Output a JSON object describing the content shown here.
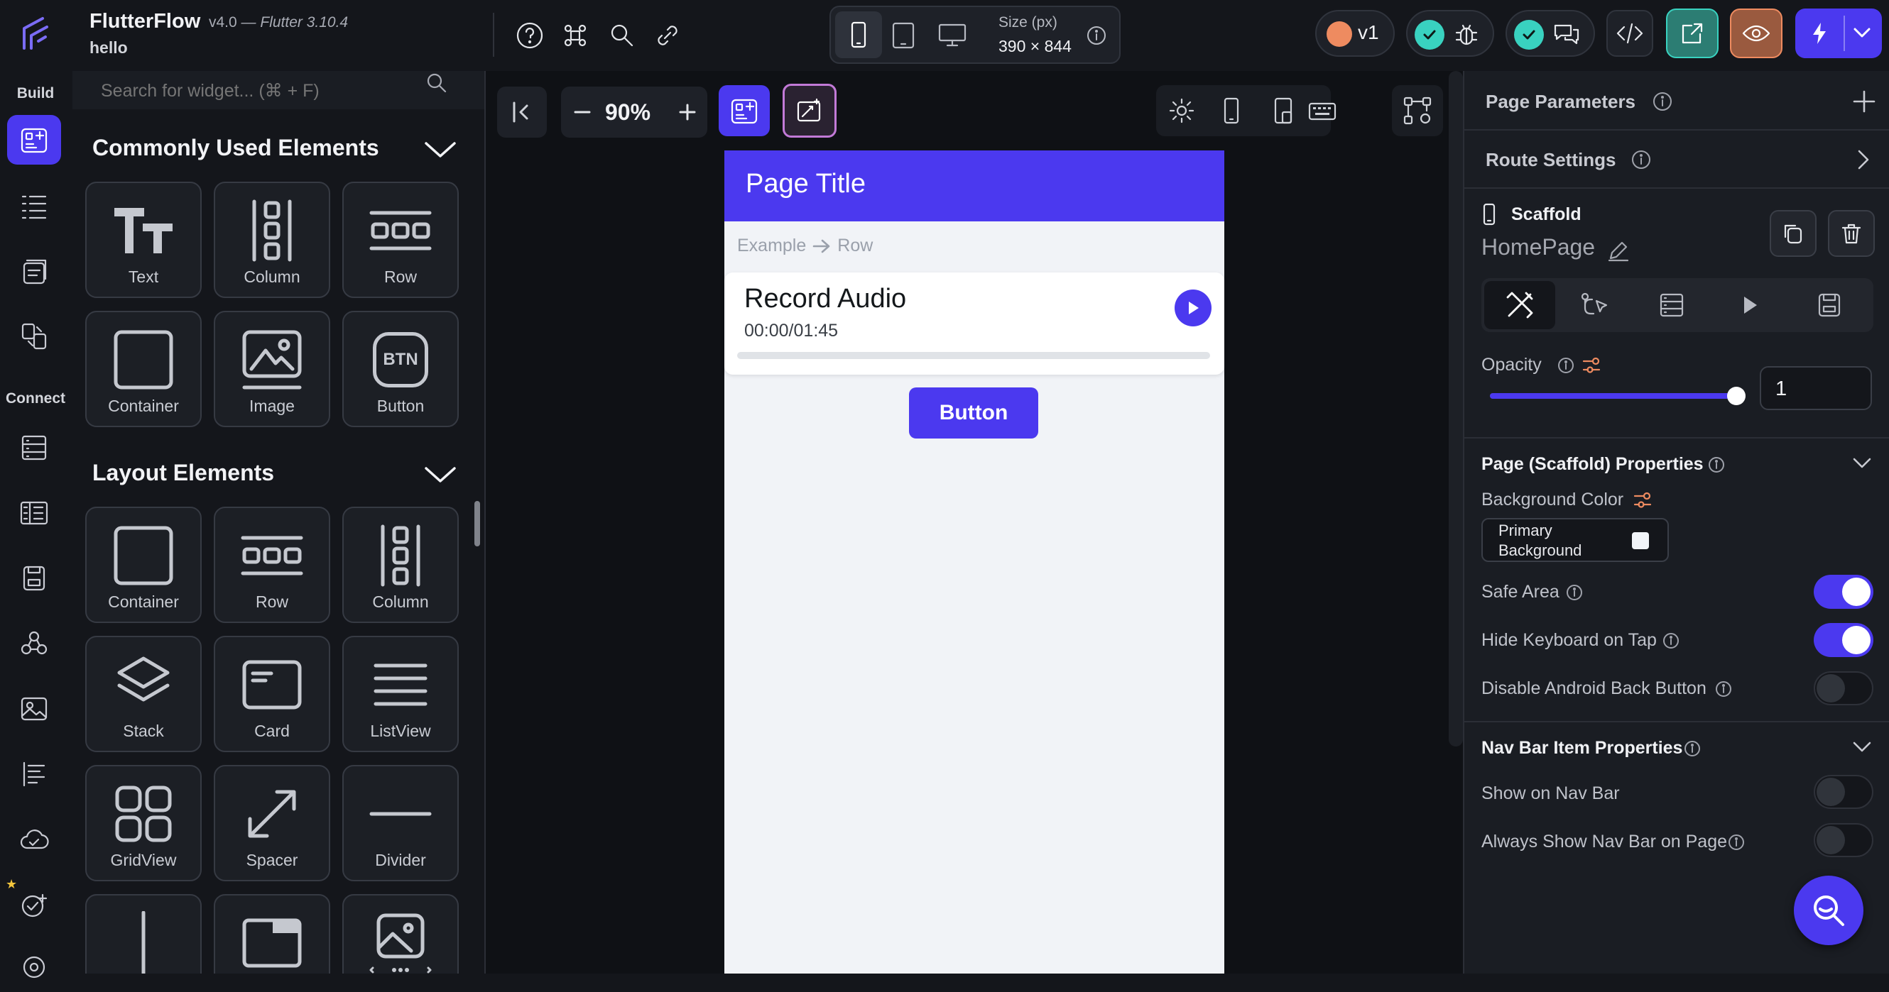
{
  "app": {
    "name": "FlutterFlow",
    "version": "v4.0",
    "flutter_version": "— Flutter 3.10.4",
    "project": "hello"
  },
  "topbar": {
    "size_label": "Size (px)",
    "size_value": "390 × 844",
    "version_badge": "v1"
  },
  "rail": {
    "build_label": "Build",
    "connect_label": "Connect"
  },
  "widget_panel": {
    "search_placeholder": "Search for widget... (⌘ + F)",
    "sections": [
      {
        "title": "Commonly Used Elements",
        "items": [
          {
            "label": "Text",
            "icon": "text-icon"
          },
          {
            "label": "Column",
            "icon": "column-icon"
          },
          {
            "label": "Row",
            "icon": "row-icon"
          },
          {
            "label": "Container",
            "icon": "container-icon"
          },
          {
            "label": "Image",
            "icon": "image-icon"
          },
          {
            "label": "Button",
            "icon": "button-icon"
          }
        ]
      },
      {
        "title": "Layout Elements",
        "items": [
          {
            "label": "Container",
            "icon": "container-icon"
          },
          {
            "label": "Row",
            "icon": "row-icon"
          },
          {
            "label": "Column",
            "icon": "column-icon"
          },
          {
            "label": "Stack",
            "icon": "stack-icon"
          },
          {
            "label": "Card",
            "icon": "card-icon"
          },
          {
            "label": "ListView",
            "icon": "listview-icon"
          },
          {
            "label": "GridView",
            "icon": "gridview-icon"
          },
          {
            "label": "Spacer",
            "icon": "spacer-icon"
          },
          {
            "label": "Divider",
            "icon": "divider-icon"
          }
        ]
      }
    ],
    "btn_glyph": "BTN"
  },
  "canvas": {
    "zoom": "90%",
    "page_title": "Page Title",
    "breadcrumb_left": "Example",
    "breadcrumb_right": "Row",
    "audio_title": "Record Audio",
    "audio_time": "00:00/01:45",
    "button_label": "Button",
    "audio_progress": 0
  },
  "props": {
    "page_parameters": "Page Parameters",
    "route_settings": "Route Settings",
    "widget_type": "Scaffold",
    "widget_name": "HomePage",
    "opacity_label": "Opacity",
    "opacity_value": "1",
    "scaffold_props_title": "Page (Scaffold) Properties",
    "background_color_label": "Background Color",
    "background_color_value": "Primary Background",
    "safe_area_label": "Safe Area",
    "hide_keyboard_label": "Hide Keyboard on Tap",
    "disable_back_label": "Disable Android Back Button",
    "nav_bar_title": "Nav Bar Item Properties",
    "show_nav_label": "Show on Nav Bar",
    "always_show_nav_label": "Always Show Nav Bar on Page",
    "toggles": {
      "safe_area": true,
      "hide_keyboard": true,
      "disable_back": false,
      "show_nav": false,
      "always_show_nav": false
    }
  },
  "colors": {
    "accent": "#4b39ef",
    "success": "#39d2c0",
    "warning": "#ee8b60"
  }
}
